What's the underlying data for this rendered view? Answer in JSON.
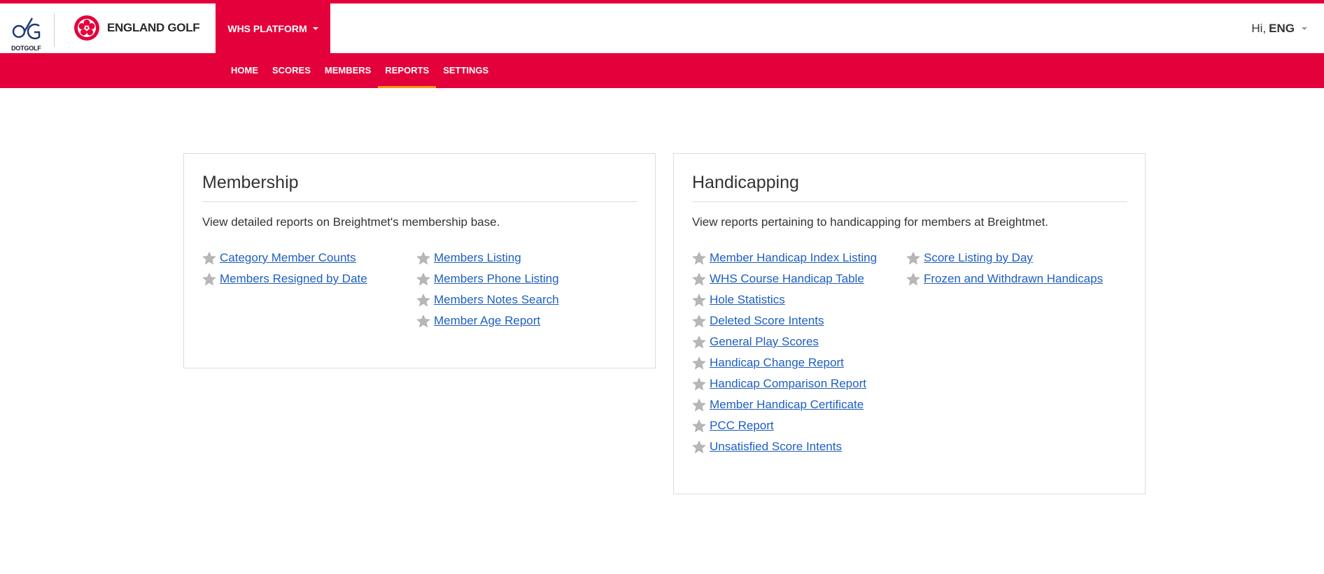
{
  "branding": {
    "dotgolf_text": "DOTGOLF",
    "england_golf_text": "ENGLAND GOLF",
    "brand_color": "#e4003b",
    "active_underline_color": "#f7941d"
  },
  "header": {
    "platform_menu_label": "WHS PLATFORM",
    "greeting": "Hi,",
    "user_name": "ENG"
  },
  "nav": {
    "items": [
      "HOME",
      "SCORES",
      "MEMBERS",
      "REPORTS",
      "SETTINGS"
    ],
    "active": "REPORTS"
  },
  "membership": {
    "title": "Membership",
    "description": "View detailed reports on Breightmet's membership base.",
    "col1": [
      "Category Member Counts",
      "Members Resigned by Date"
    ],
    "col2": [
      "Members Listing",
      "Members Phone Listing",
      "Members Notes Search",
      "Member Age Report"
    ]
  },
  "handicapping": {
    "title": "Handicapping",
    "description": "View reports pertaining to handicapping for members at Breightmet.",
    "col1": [
      "Member Handicap Index Listing",
      "WHS Course Handicap Table",
      "Hole Statistics",
      "Deleted Score Intents",
      "General Play Scores",
      "Handicap Change Report",
      "Handicap Comparison Report",
      "Member Handicap Certificate",
      "PCC Report",
      "Unsatisfied Score Intents"
    ],
    "col2": [
      "Score Listing by Day",
      "Frozen and Withdrawn Handicaps"
    ]
  },
  "icons": {
    "favourite": "star-icon"
  }
}
